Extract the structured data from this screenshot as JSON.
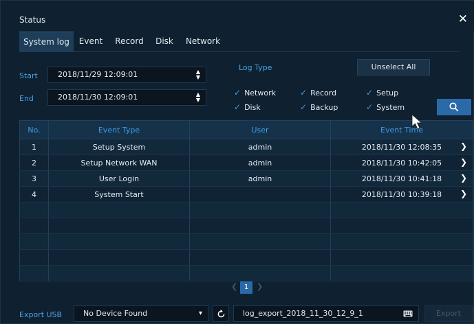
{
  "window": {
    "title": "Status"
  },
  "tabs": [
    {
      "label": "System log",
      "active": true
    },
    {
      "label": "Event",
      "active": false
    },
    {
      "label": "Record",
      "active": false
    },
    {
      "label": "Disk",
      "active": false
    },
    {
      "label": "Network",
      "active": false
    }
  ],
  "filters": {
    "start_label": "Start",
    "start_value": "2018/11/29 12:09:01",
    "end_label": "End",
    "end_value": "2018/11/30 12:09:01",
    "log_type_label": "Log Type",
    "unselect_all_label": "Unselect All",
    "log_types": [
      {
        "label": "Network",
        "checked": true
      },
      {
        "label": "Record",
        "checked": true
      },
      {
        "label": "Setup",
        "checked": true
      },
      {
        "label": "Disk",
        "checked": true
      },
      {
        "label": "Backup",
        "checked": true
      },
      {
        "label": "System",
        "checked": true
      }
    ]
  },
  "table": {
    "headers": [
      "No.",
      "Event Type",
      "User",
      "Event Time"
    ],
    "rows": [
      {
        "no": "1",
        "event_type": "Setup System",
        "user": "admin",
        "time": "2018/11/30 12:08:35"
      },
      {
        "no": "2",
        "event_type": "Setup Network WAN",
        "user": "admin",
        "time": "2018/11/30 10:42:05"
      },
      {
        "no": "3",
        "event_type": "User Login",
        "user": "admin",
        "time": "2018/11/30 10:41:18"
      },
      {
        "no": "4",
        "event_type": "System Start",
        "user": "",
        "time": "2018/11/30 10:39:18"
      }
    ]
  },
  "pager": {
    "current_page": "1"
  },
  "bottom": {
    "export_usb_label": "Export USB",
    "device_value": "No Device Found",
    "filename_value": "log_export_2018_11_30_12_9_1",
    "export_label": "Export"
  },
  "colors": {
    "accent": "#3f9be6",
    "button": "#2a6aa8",
    "background": "#0f2030"
  }
}
